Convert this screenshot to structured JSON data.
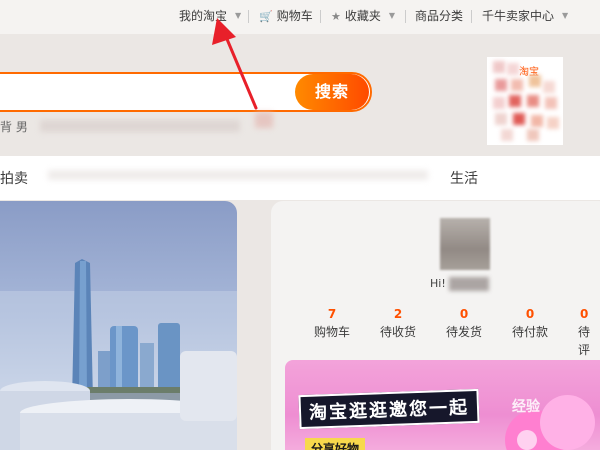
{
  "topnav": {
    "my_taobao": "我的淘宝",
    "cart": "购物车",
    "favorites": "收藏夹",
    "categories": "商品分类",
    "seller_center": "千牛卖家中心"
  },
  "search": {
    "button_label": "搜索",
    "hot_words_partial": "背 男"
  },
  "qr": {
    "label": "淘宝"
  },
  "category_strip": {
    "left_partial": "拍卖",
    "right_partial": "生活"
  },
  "user_card": {
    "greeting": "Hi!",
    "stats": [
      {
        "count": "7",
        "label": "购物车"
      },
      {
        "count": "2",
        "label": "待收货"
      },
      {
        "count": "0",
        "label": "待发货"
      },
      {
        "count": "0",
        "label": "待付款"
      },
      {
        "count": "0",
        "label": "待评"
      }
    ]
  },
  "promo": {
    "title": "淘宝逛逛邀您一起",
    "subtitle": "分享好物"
  },
  "watermark": "经验",
  "colors": {
    "accent": "#ff5000",
    "annotation_arrow": "#e8202a"
  }
}
